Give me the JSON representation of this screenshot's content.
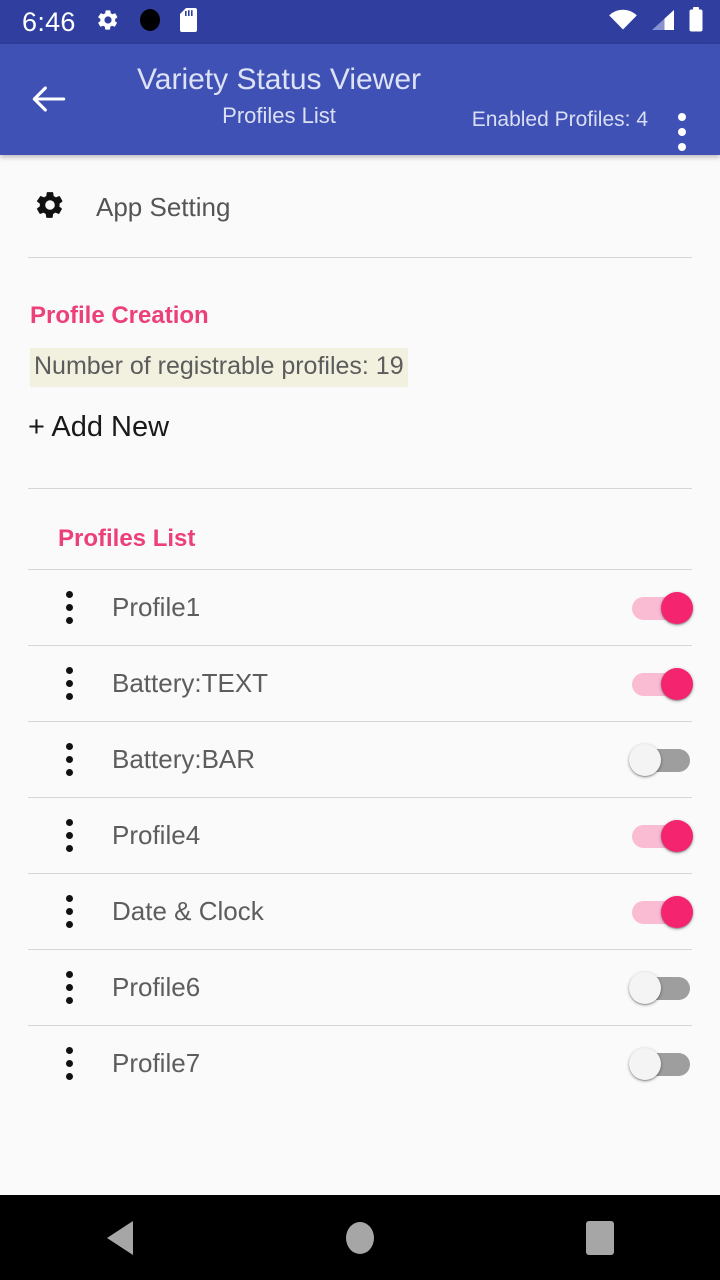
{
  "status_bar": {
    "time": "6:46",
    "icons_left": [
      "gear-icon",
      "filled-circle-icon",
      "sd-card-icon"
    ],
    "icons_right": [
      "wifi-icon",
      "cellular-signal-icon",
      "battery-icon"
    ]
  },
  "app_bar": {
    "back_icon": "back-arrow-icon",
    "title": "Variety Status Viewer",
    "subtitle": "Profiles List",
    "enabled_profiles": "Enabled Profiles: 4",
    "overflow_icon": "overflow-menu-icon",
    "background_color": "#3f51b5"
  },
  "app_setting": {
    "icon": "gear-icon",
    "label": "App Setting"
  },
  "profile_creation": {
    "section_title": "Profile Creation",
    "registrable_text": "Number of registrable profiles: 19",
    "add_new_label": "+ Add New",
    "accent_color": "#ec407a",
    "highlight_color": "#f2f0de"
  },
  "profiles_list": {
    "section_title": "Profiles List",
    "accent_color": "#ec407a",
    "switch_on_color": "#f5246f",
    "switch_off_color": "#9e9e9e",
    "rows": [
      {
        "name": "Profile1",
        "enabled": true,
        "state": "on"
      },
      {
        "name": "Battery:TEXT",
        "enabled": true,
        "state": "on"
      },
      {
        "name": "Battery:BAR",
        "enabled": false,
        "state": "off"
      },
      {
        "name": "Profile4",
        "enabled": true,
        "state": "on"
      },
      {
        "name": "Date & Clock",
        "enabled": true,
        "state": "on"
      },
      {
        "name": "Profile6",
        "enabled": false,
        "state": "off"
      },
      {
        "name": "Profile7",
        "enabled": false,
        "state": "off"
      }
    ]
  },
  "nav_bar": {
    "back": "nav-back-icon",
    "home": "nav-home-icon",
    "recents": "nav-recents-icon"
  }
}
